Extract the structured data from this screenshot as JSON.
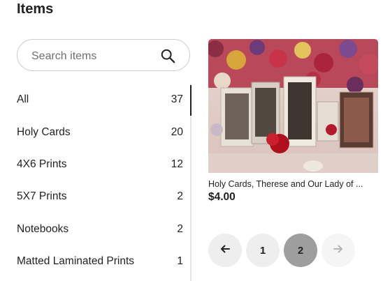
{
  "page": {
    "title": "Items"
  },
  "search": {
    "placeholder": "Search items",
    "value": "",
    "icon": "search-icon"
  },
  "sections": [
    {
      "label": "All",
      "count": "37",
      "active": true
    },
    {
      "label": "Holy Cards",
      "count": "20"
    },
    {
      "label": "4X6 Prints",
      "count": "12"
    },
    {
      "label": "5X7 Prints",
      "count": "2"
    },
    {
      "label": "Notebooks",
      "count": "2"
    },
    {
      "label": "Matted Laminated Prints",
      "count": "1"
    }
  ],
  "product": {
    "title": "Holy Cards, Therese and Our Lady of ...",
    "price": "$4.00"
  },
  "pagination": {
    "prev_icon": "arrow-left-icon",
    "next_icon": "arrow-right-icon",
    "pages": [
      "1",
      "2"
    ],
    "current_page": "2"
  },
  "colors": {
    "page_button_bg": "#eeeeee",
    "page_button_active_bg": "#9e9e9e",
    "next_disabled_bg": "#f5f5f5"
  }
}
